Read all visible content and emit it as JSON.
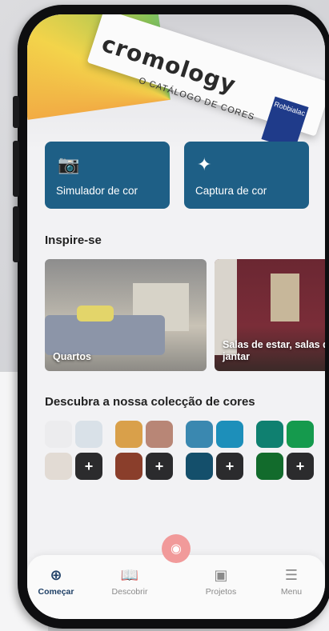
{
  "hero": {
    "brand": "cromology",
    "subtitle": "O CATÁLOGO DE CORES",
    "badge": "Robbialac"
  },
  "tiles": [
    {
      "label": "Simulador de cor",
      "icon": "camera-icon"
    },
    {
      "label": "Captura de cor",
      "icon": "eyedropper-icon"
    }
  ],
  "inspire": {
    "title": "Inspire-se",
    "cards": [
      {
        "label": "Quartos"
      },
      {
        "label": "Salas de estar, salas de jantar"
      }
    ]
  },
  "collection": {
    "title": "Descubra a nossa colecção de cores",
    "groups": [
      {
        "colors": [
          "#ececee",
          "#d9e1e8",
          "#e2dbd4"
        ],
        "plus": "+"
      },
      {
        "colors": [
          "#d9a04a",
          "#b88676",
          "#8a3e2b"
        ],
        "plus": "+"
      },
      {
        "colors": [
          "#3a88b0",
          "#1d8fba",
          "#144f6b"
        ],
        "plus": "+"
      },
      {
        "colors": [
          "#0f8070",
          "#159a4d",
          "#126b2c"
        ],
        "plus": "+"
      }
    ]
  },
  "tabbar": {
    "items": [
      {
        "label": "Começar",
        "icon": "crosshair-icon",
        "active": true
      },
      {
        "label": "Descobrir",
        "icon": "book-icon",
        "active": false
      },
      {
        "label": "Projetos",
        "icon": "project-icon",
        "active": false
      },
      {
        "label": "Menu",
        "icon": "hamburger-icon",
        "active": false
      }
    ]
  },
  "fab": {
    "icon": "camera-icon"
  },
  "colors": {
    "tile": "#1e5f86",
    "active_tab": "#1e3f66",
    "fab": "#f19a9a"
  }
}
